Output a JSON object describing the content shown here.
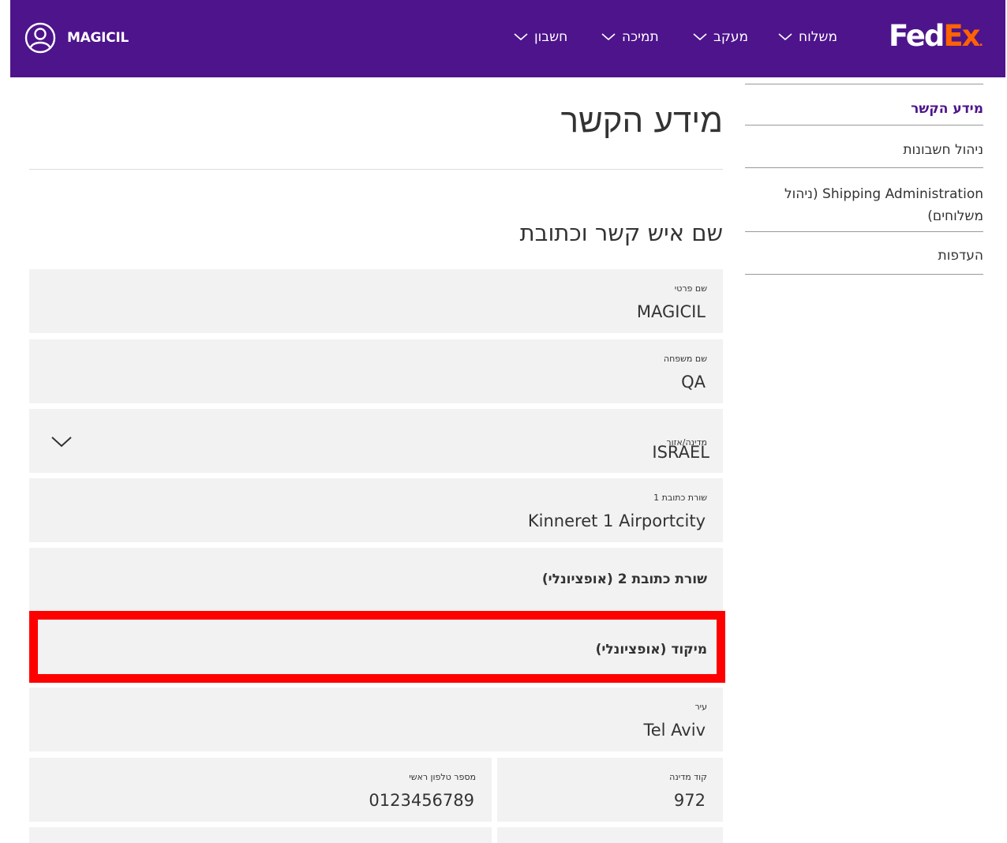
{
  "header": {
    "user_name": "MAGICIL",
    "nav": [
      {
        "label": "חשבון"
      },
      {
        "label": "תמיכה"
      },
      {
        "label": "מעקב"
      },
      {
        "label": "משלוח"
      }
    ],
    "logo": {
      "fed": "Fed",
      "ex": "Ex",
      "dot": "."
    },
    "colors": {
      "brand_purple": "#4d148c",
      "brand_orange": "#ff6200"
    }
  },
  "sidebar": {
    "items": [
      {
        "label": "מידע הקשר",
        "active": true
      },
      {
        "label": "ניהול חשבונות"
      },
      {
        "label": "Shipping Administration (ניהול משלוחים)"
      },
      {
        "label": "העדפות"
      }
    ]
  },
  "main": {
    "title": "מידע הקשר",
    "section_title": "שם איש קשר וכתובת",
    "fields": {
      "first_name": {
        "label": "שם פרטי",
        "value": "MAGICIL"
      },
      "last_name": {
        "label": "שם משפחה",
        "value": "QA"
      },
      "country": {
        "label": "מדינה/אזור",
        "value": "ISRAEL"
      },
      "address1": {
        "label": "שורת כתובת 1",
        "value": "Kinneret 1 Airportcity"
      },
      "address2": {
        "placeholder": "שורת כתובת 2 (אופציונלי)"
      },
      "postal": {
        "placeholder": "מיקוד (אופציונלי)"
      },
      "city": {
        "label": "עיר",
        "value": "Tel Aviv"
      },
      "country_code": {
        "label": "קוד מדינה",
        "value": "972"
      },
      "phone": {
        "label": "מספר טלפון ראשי",
        "value": "0123456789"
      }
    },
    "highlight_color": "#ff0000"
  }
}
